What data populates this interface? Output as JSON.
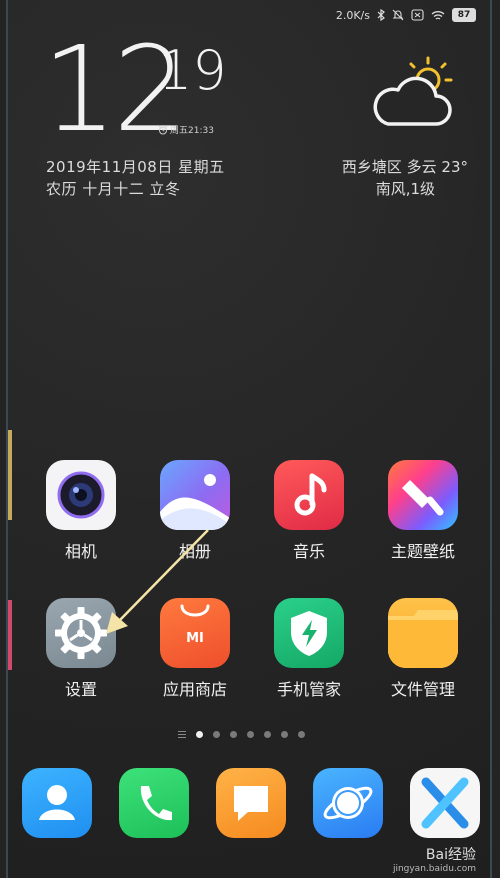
{
  "status_bar": {
    "net_speed": "2.0K/s",
    "battery": "87"
  },
  "clock": {
    "hour": "12",
    "minute": "19",
    "alarm": "周五21:33"
  },
  "date": {
    "line1": "2019年11月08日 星期五",
    "line2": "农历 十月十二 立冬"
  },
  "weather": {
    "line1": "西乡塘区  多云  23°",
    "line2": "南风,1级"
  },
  "apps": [
    {
      "label": "相机"
    },
    {
      "label": "相册"
    },
    {
      "label": "音乐"
    },
    {
      "label": "主题壁纸"
    },
    {
      "label": "设置"
    },
    {
      "label": "应用商店"
    },
    {
      "label": "手机管家"
    },
    {
      "label": "文件管理"
    }
  ],
  "pages": {
    "count": 8,
    "active": 0
  },
  "watermark": {
    "brand": "Bai经验",
    "url": "jingyan.baidu.com"
  },
  "colors": {
    "music": "#e8383f",
    "security": "#1fb873",
    "files": "#f5a623",
    "store": "#f2613a",
    "settings": "#8a99a3"
  }
}
